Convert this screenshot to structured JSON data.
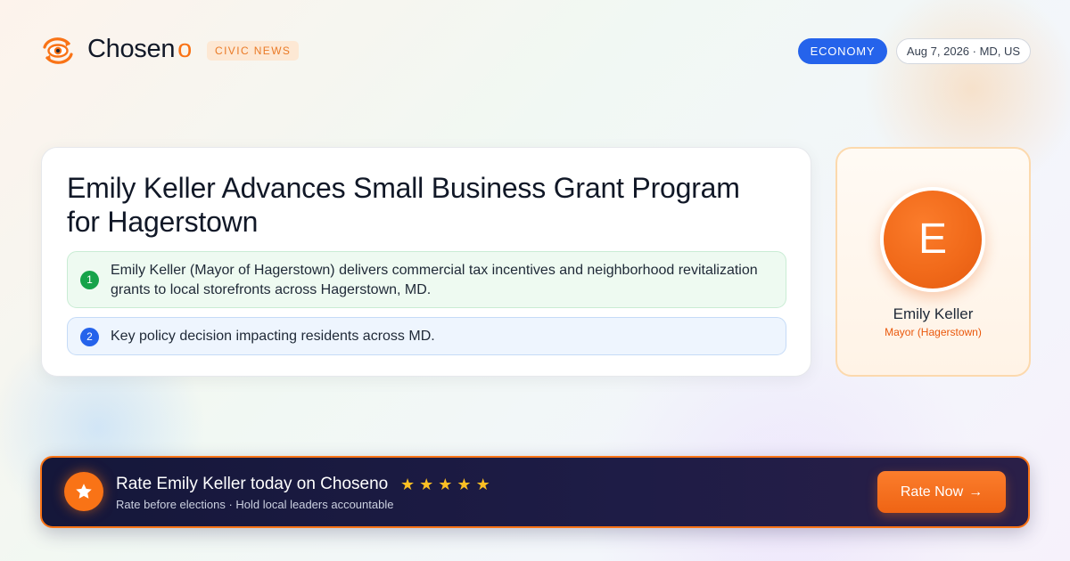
{
  "brand": {
    "name": "Chosen",
    "name_suffix": "o",
    "tag": "CIVIC NEWS",
    "accent_color": "#f97316",
    "logo_icon": "eye-refresh-icon"
  },
  "header": {
    "category": "ECONOMY",
    "date_location": "Aug 7, 2026 · MD, US"
  },
  "article": {
    "headline": "Emily Keller Advances Small Business Grant Program for Hagerstown",
    "points": [
      {
        "number": "1",
        "text": "Emily Keller (Mayor of Hagerstown) delivers commercial tax incentives and neighborhood revitalization grants to local storefronts across Hagerstown, MD.",
        "color": "#16a34a"
      },
      {
        "number": "2",
        "text": "Key policy decision impacting residents across MD.",
        "color": "#2563eb"
      }
    ]
  },
  "profile": {
    "initial": "E",
    "name": "Emily Keller",
    "role": "Mayor (Hagerstown)"
  },
  "cta": {
    "title": "Rate Emily Keller today on Choseno",
    "stars": [
      "★",
      "★",
      "★",
      "★",
      "★"
    ],
    "subtitle": "Rate before elections · Hold local leaders accountable",
    "button_label": "Rate Now",
    "button_arrow": "→",
    "badge_icon": "star-icon"
  }
}
